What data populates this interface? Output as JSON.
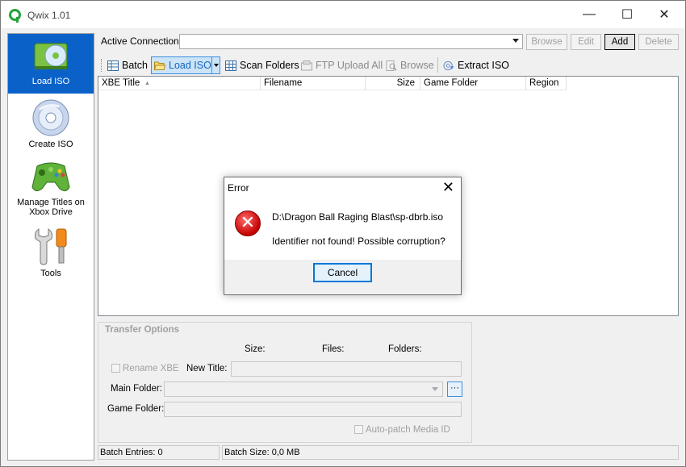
{
  "window": {
    "title": "Qwix 1.01",
    "min_glyph": "—",
    "max_glyph": "☐",
    "close_glyph": "✕"
  },
  "sidebar": {
    "items": [
      {
        "label": "Load ISO",
        "icon": "disc-drive-icon",
        "active": true
      },
      {
        "label": "Create ISO",
        "icon": "cd-icon"
      },
      {
        "label": "Manage Titles on Xbox Drive",
        "icon": "gamepad-icon"
      },
      {
        "label": "Tools",
        "icon": "tools-icon"
      }
    ]
  },
  "connection": {
    "label": "Active Connection:",
    "value": ""
  },
  "conn_buttons": {
    "browse": "Browse",
    "edit": "Edit",
    "add": "Add",
    "delete": "Delete"
  },
  "toolbar": {
    "batch": "Batch",
    "load_iso": "Load ISO",
    "scan_folders": "Scan Folders",
    "ftp_upload_all": "FTP Upload All",
    "browse": "Browse",
    "extract_iso": "Extract ISO"
  },
  "list": {
    "columns": [
      "XBE Title",
      "Filename",
      "Size",
      "Game Folder",
      "Region"
    ],
    "sort_glyph": "▲",
    "rows": []
  },
  "transfer": {
    "title": "Transfer Options",
    "size_label": "Size:",
    "files_label": "Files:",
    "folders_label": "Folders:",
    "rename_xbe": "Rename XBE",
    "new_title": "New Title:",
    "main_folder": "Main Folder:",
    "game_folder": "Game Folder:",
    "auto_patch": "Auto-patch Media ID",
    "dots": "···"
  },
  "status": {
    "batch_entries": "Batch Entries: 0",
    "batch_size": "Batch Size: 0,0 MB"
  },
  "dialog": {
    "title": "Error",
    "close_glyph": "✕",
    "icon_glyph": "✕",
    "message_path": "D:\\Dragon Ball Raging Blast\\sp-dbrb.iso",
    "message": "Identifier not found! Possible corruption?",
    "button": "Cancel"
  },
  "colors": {
    "accent": "#0a62c9",
    "error_red": "#c40000",
    "selection": "#cce4f7"
  }
}
